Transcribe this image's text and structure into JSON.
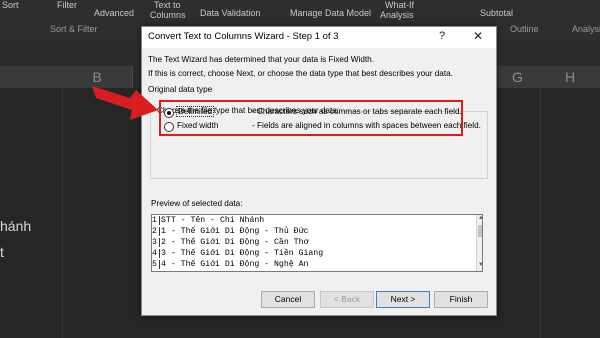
{
  "ribbon": {
    "items": [
      "Sort",
      "Filter",
      "Advanced",
      "Text to",
      "Columns",
      "Data Validation",
      "Manage Data Model",
      "What-If",
      "Analysis",
      "Subtotal"
    ],
    "groups": [
      "Sort & Filter",
      "Outline",
      "Analysis"
    ]
  },
  "sheet": {
    "columns": [
      "B",
      "G",
      "H"
    ],
    "cells": [
      "hánh",
      "t"
    ]
  },
  "dialog": {
    "title": "Convert Text to Columns Wizard - Step 1 of 3",
    "help": "?",
    "close": "✕",
    "intro1": "The Text Wizard has determined that your data is Fixed Width.",
    "intro2": "If this is correct, choose Next, or choose the data type that best describes your data.",
    "group_label": "Original data type",
    "choose_label": "Choose the file type that best describes your data:",
    "options": [
      {
        "label": "Delimited",
        "desc": "- Characters such as commas or tabs separate each field.",
        "selected": true
      },
      {
        "label": "Fixed width",
        "desc": "- Fields are aligned in columns with spaces between each field.",
        "selected": false
      }
    ],
    "preview_label": "Preview of selected data:",
    "preview_rows": [
      {
        "num": "1",
        "text": "STT - Tên - Chi Nhánh"
      },
      {
        "num": "2",
        "text": "1 - Thế Giới Di Động - Thủ Đức"
      },
      {
        "num": "3",
        "text": "2 - Thế Giới Di Động - Cần Thơ"
      },
      {
        "num": "4",
        "text": "3 - Thế Giới Di Động - Tiền Giang"
      },
      {
        "num": "5",
        "text": "4 - Thế Giới Di Động - Nghệ An"
      }
    ],
    "buttons": {
      "cancel": "Cancel",
      "back": "< Back",
      "next": "Next >",
      "finish": "Finish"
    }
  },
  "colors": {
    "highlight": "#d81e1e",
    "dialog_bg": "#f0f0f0"
  }
}
